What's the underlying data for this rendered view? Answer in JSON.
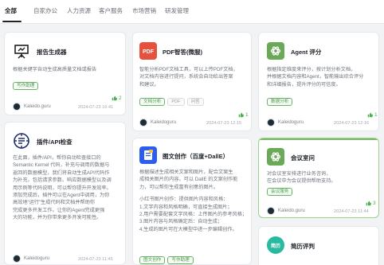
{
  "tabs": [
    "全部",
    "自家办公",
    "人力资源",
    "客户服务",
    "市场营销",
    "研发管理"
  ],
  "accent": "#4caf50",
  "cards": {
    "report": {
      "title": "报告生成器",
      "desc": [
        "根据关键字自动生成高质量文档或报告"
      ],
      "tags": [
        "写作助理"
      ],
      "likes": "2",
      "author": "Kaleido.guru",
      "time": "2024-07-23 16:41"
    },
    "pdf": {
      "title": "PDF智答(微服)",
      "desc": [
        "智能分析PDF文档工具，可以上传PDF文档，",
        "对文档内容进行提问，系统会自动给出答案",
        "和建议。"
      ],
      "tags": [
        "文档分析",
        "PDF",
        "问答"
      ],
      "likes": "1",
      "author": "Kaleidoguru",
      "time": "2024-07-23 12:15"
    },
    "agent": {
      "title": "Agent 评分",
      "desc": [
        "根据指定维度来评分，按计划分析文档，",
        "并根据文档内容和Agent，智能输出综合评分",
        "和详细报告，提升评分的可信度。"
      ],
      "tags": [
        "数据分析"
      ],
      "likes": "1",
      "author": "Kaleidoguru",
      "time": "2024-07-23 12:16"
    },
    "api": {
      "title": "插件/API检查",
      "desc": [
        "在此面，插件/API，帮你自动检查接口的",
        "Semantic Kernel 代码，补充与调用的数据与",
        "返回的数据模型，我们将自动生成API代码作",
        "为补充，包括请求参数、响应数据模型以及调",
        "用示例等代码说明，可以帮你提升开发效率。",
        "添加完成后，插件可以在Agent中调用，为你",
        "高效地“运行”生成代码和文档并帮助你",
        "完成更多开发工作。让你的Agent完成更强",
        "大的功能，并为你带来更多开发可能性。"
      ],
      "author": "Kaleidoguru",
      "time": "2024-07-23 11:45"
    },
    "illus": {
      "title": "图文创作（百度+DallE）",
      "desc": [
        "根据描述生成相关文案和图片，配合文案生",
        "成相关图片的内容。可以 DallE 的文案创作能",
        "力，可以帮你生成富有创意的图片。",
        "",
        "小红书图片创作：提供图片内容和风格：",
        "1.文字内容和风格明确，可直接生成图片；",
        "2.用户需要配套文字风格：上传图片的参考风格；",
        "3.图片内容与风格确定后：自动生成；",
        "4.生成的图片可在大模型中进一步编辑创作。"
      ],
      "tags": [
        "图文创作",
        "写作助理"
      ],
      "author": "Kaleidoguru",
      "time": "2024-07-23 11:45"
    },
    "meeting": {
      "title": "会议室问",
      "desc": [
        "对会议室安排进行业务咨询，",
        "在会议中为会议提供帮助支持。"
      ],
      "tags": [
        "会议服务"
      ],
      "likes": "3",
      "author": "Kaleido.guru",
      "time": "2024-07-23 11:44"
    },
    "brief": {
      "title": "简历评判",
      "badge": "简历"
    }
  }
}
